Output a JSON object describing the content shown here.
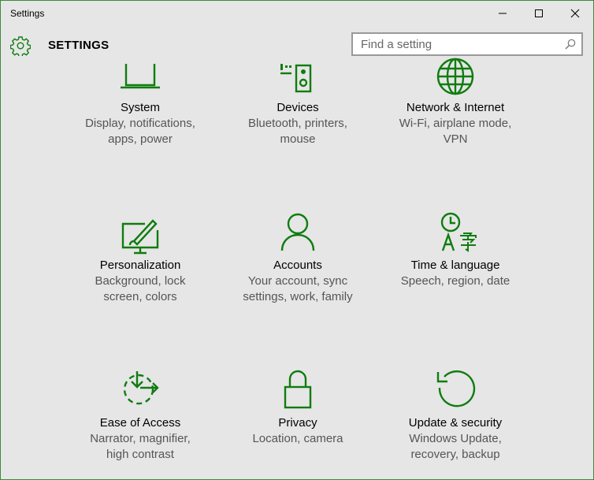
{
  "window": {
    "title": "Settings",
    "controls": [
      "minimize",
      "maximize",
      "close"
    ]
  },
  "header": {
    "title": "SETTINGS",
    "icon": "gear-icon"
  },
  "search": {
    "placeholder": "Find a setting",
    "value": ""
  },
  "accent_color": "#107c10",
  "categories": [
    {
      "name": "System",
      "desc1": "Display, notifications,",
      "desc2": "apps, power",
      "icon": "laptop-icon"
    },
    {
      "name": "Devices",
      "desc1": "Bluetooth, printers,",
      "desc2": "mouse",
      "icon": "devices-icon"
    },
    {
      "name": "Network & Internet",
      "desc1": "Wi-Fi, airplane mode,",
      "desc2": "VPN",
      "icon": "globe-icon"
    },
    {
      "name": "Personalization",
      "desc1": "Background, lock",
      "desc2": "screen, colors",
      "icon": "personalization-icon"
    },
    {
      "name": "Accounts",
      "desc1": "Your account, sync",
      "desc2": "settings, work, family",
      "icon": "person-icon"
    },
    {
      "name": "Time & language",
      "desc1": "Speech, region, date",
      "desc2": "",
      "icon": "time-language-icon"
    },
    {
      "name": "Ease of Access",
      "desc1": "Narrator, magnifier,",
      "desc2": "high contrast",
      "icon": "ease-of-access-icon"
    },
    {
      "name": "Privacy",
      "desc1": "Location, camera",
      "desc2": "",
      "icon": "lock-icon"
    },
    {
      "name": "Update & security",
      "desc1": "Windows Update,",
      "desc2": "recovery, backup",
      "icon": "update-icon"
    }
  ]
}
